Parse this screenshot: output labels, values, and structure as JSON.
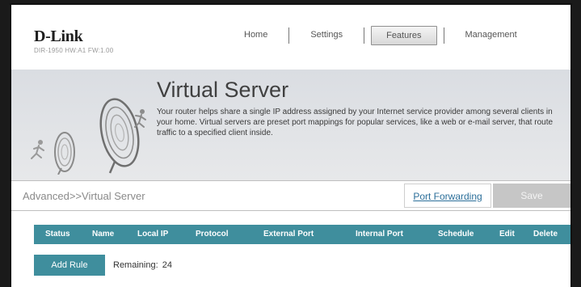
{
  "header": {
    "brand": "D-Link",
    "model_info": "DIR-1950 HW:A1 FW:1.00",
    "nav": [
      {
        "label": "Home",
        "active": false
      },
      {
        "label": "Settings",
        "active": false
      },
      {
        "label": "Features",
        "active": true
      },
      {
        "label": "Management",
        "active": false
      }
    ]
  },
  "banner": {
    "title": "Virtual Server",
    "description": "Your router helps share a single IP address assigned by your Internet service provider among several clients in your home. Virtual servers are preset port mappings for popular services, like a web or e-mail server, that route traffic to a specified client inside."
  },
  "breadcrumb": "Advanced>>Virtual Server",
  "actions": {
    "port_forwarding_label": "Port Forwarding",
    "save_label": "Save"
  },
  "table": {
    "columns": [
      "Status",
      "Name",
      "Local IP",
      "Protocol",
      "External Port",
      "Internal Port",
      "Schedule",
      "Edit",
      "Delete"
    ]
  },
  "rules": {
    "add_rule_label": "Add Rule",
    "remaining_label": "Remaining:",
    "remaining_count": "24"
  },
  "colors": {
    "accent": "#3f8e9d",
    "link": "#2c6f9a",
    "disabled_button": "#c6c6c6"
  },
  "icons": [
    "runner-icon",
    "dish-antenna-icon"
  ]
}
